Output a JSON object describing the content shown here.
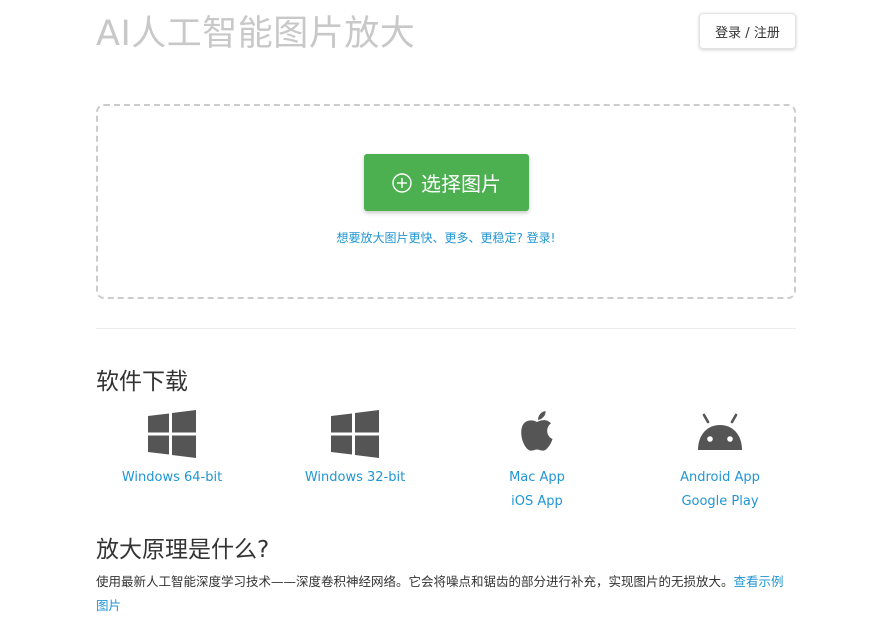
{
  "header": {
    "title": "AI人工智能图片放大",
    "login_label": "登录 / 注册"
  },
  "upload": {
    "button_label": "选择图片",
    "button_icon": "plus-circle-icon",
    "upgrade_text": "想要放大图片更快、更多、更稳定? 登录!"
  },
  "downloads": {
    "heading": "软件下载",
    "items": [
      {
        "icon": "windows-icon",
        "links": [
          "Windows 64-bit"
        ]
      },
      {
        "icon": "windows-icon",
        "links": [
          "Windows 32-bit"
        ]
      },
      {
        "icon": "apple-icon",
        "links": [
          "Mac App",
          "iOS App"
        ]
      },
      {
        "icon": "android-icon",
        "links": [
          "Android App",
          "Google Play"
        ]
      }
    ]
  },
  "principle": {
    "heading": "放大原理是什么?",
    "text": "使用最新人工智能深度学习技术——深度卷积神经网络。它会将噪点和锯齿的部分进行补充，实现图片的无损放大。",
    "link_text": "查看示例图片"
  },
  "colors": {
    "accent_green": "#4caf50",
    "link_blue": "#2196d3",
    "title_gray": "#c8c8c8",
    "icon_gray": "#555555"
  }
}
